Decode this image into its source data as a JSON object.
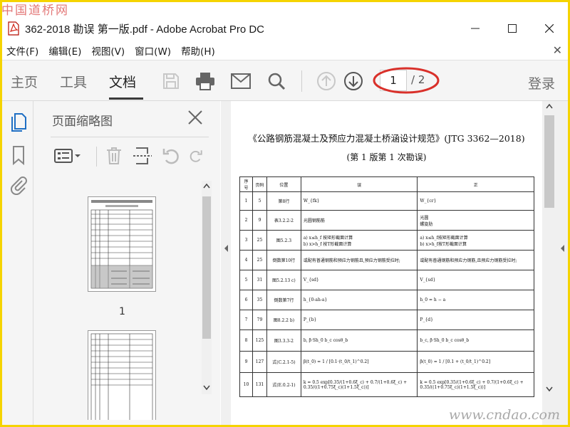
{
  "watermarks": {
    "top": "中国道桥网",
    "bottom": "www.cndao.com"
  },
  "window": {
    "title": "362-2018 勘误 第一版.pdf - Adobe Acrobat Pro DC"
  },
  "menu": [
    "文件(F)",
    "编辑(E)",
    "视图(V)",
    "窗口(W)",
    "帮助(H)"
  ],
  "toolbar": {
    "tabs": [
      "主页",
      "工具",
      "文档"
    ],
    "active_tab": "文档",
    "current_page": "1",
    "total_pages": "/ 2",
    "login": "登录",
    "annotation_color": "#d9302a"
  },
  "sidebar": {
    "title": "页面缩略图",
    "thumb_label": "1"
  },
  "document": {
    "title": "《公路钢筋混凝土及预应力混凝土桥涵设计规范》(JTG 3362—2018)",
    "subtitle": "(第 1 版第 1 次勘误)",
    "headers": [
      "序号",
      "页码",
      "位置",
      "误",
      "正"
    ],
    "rows": [
      [
        "1",
        "5",
        "第8行",
        "W_{fk}",
        "W_{cr}"
      ],
      [
        "2",
        "9",
        "表3.2.2-2",
        "光圆钢筋筋",
        "光圆\n螺旋肋"
      ],
      [
        "3",
        "25",
        "图5.2.3",
        "a) x≤h_f 按矩形截面计算\nb) x>h_f 按T形截面计算",
        "a) x≤h_f按矩形截面计算\nb) x>h_f按T形截面计算"
      ],
      [
        "4",
        "25",
        "倒数第10行",
        "或配有普通钢筋和预应力钢筋且,预应力钢筋受拉时;",
        "或配有普通钢筋和预应力钢筋,且预应力钢筋受拉时;"
      ],
      [
        "5",
        "31",
        "图5.2.13 c)",
        "V_{sd}",
        "V_{sd}"
      ],
      [
        "6",
        "35",
        "倒数第7行",
        "h_{0-ah-a}",
        "h_0 = h − a"
      ],
      [
        "7",
        "79",
        "图8.2.2 b)",
        "P_{b}",
        "P_{d}"
      ],
      [
        "8",
        "125",
        "图3.3.3-2",
        "b, β·Sh_0 b_c cosθ_b",
        "b_c, β·Sh_0 b_c cosθ_b"
      ],
      [
        "9",
        "127",
        "式(C.2.1-5)",
        "β(t_0) = 1 / [0.1·(t_0/t_1)^0.2]",
        "β(t_0) = 1 / [0.1 + (t_0/t_1)^0.2]"
      ],
      [
        "10",
        "131",
        "式(E.0.2-1)",
        "k = 0.5 exp[0.35/(1+0.6ξ_c) + 0.7/(1+0.6ξ_c) + 0.35/((1+0.75ξ_c)(1+1.5ξ_c))]",
        "k = 0.5 exp[0.35/(1+0.6ξ_c) + 0.7/(1+0.6ξ_c) + 0.35/((1+0.75ξ_c)(1+1.5ξ_c))]"
      ]
    ]
  }
}
